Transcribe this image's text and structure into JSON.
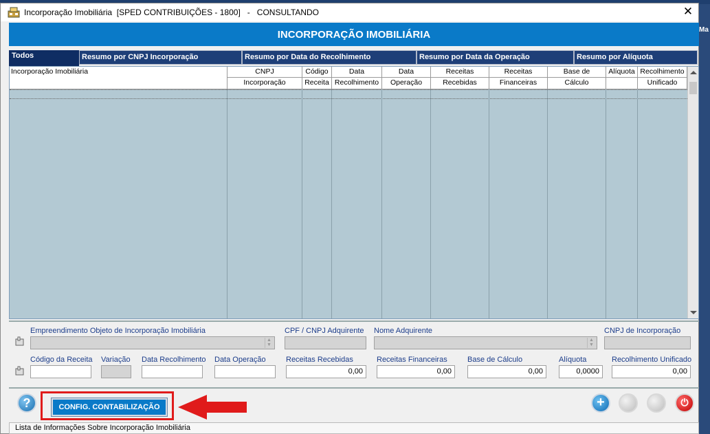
{
  "window": {
    "title": "Incorporação Imobiliária  [SPED CONTRIBUIÇÕES - 1800]   -   CONSULTANDO",
    "close_label": "✕",
    "outside_text": "Ma"
  },
  "header": {
    "title": "INCORPORAÇÃO IMOBILIÁRIA"
  },
  "tabs": [
    {
      "label": "Todos"
    },
    {
      "label": "Resumo por CNPJ Incorporação"
    },
    {
      "label": "Resumo por Data do Recolhimento"
    },
    {
      "label": "Resumo por Data da Operação"
    },
    {
      "label": "Resumo por Alíquota"
    }
  ],
  "grid": {
    "columns": [
      {
        "l1": "Incorporação Imobiliária",
        "l2": ""
      },
      {
        "l1": "CNPJ",
        "l2": "Incorporação"
      },
      {
        "l1": "Código",
        "l2": "Receita"
      },
      {
        "l1": "Data",
        "l2": "Recolhimento"
      },
      {
        "l1": "Data",
        "l2": "Operação"
      },
      {
        "l1": "Receitas",
        "l2": "Recebidas"
      },
      {
        "l1": "Receitas",
        "l2": "Financeiras"
      },
      {
        "l1": "Base de",
        "l2": "Cálculo"
      },
      {
        "l1": "Alíquota",
        "l2": ""
      },
      {
        "l1": "Recolhimento",
        "l2": "Unificado"
      }
    ]
  },
  "form": {
    "empreendimento_label": "Empreendimento Objeto de Incorporação Imobiliária",
    "cpf_label": "CPF / CNPJ Adquirente",
    "nome_label": "Nome Adquirente",
    "cnpj_inc_label": "CNPJ de Incorporação",
    "codigo_label": "Código da Receita",
    "variacao_label": "Variação",
    "data_rec_label": "Data Recolhimento",
    "data_op_label": "Data Operação",
    "rec_recebidas_label": "Receitas Recebidas",
    "rec_financeiras_label": "Receitas Financeiras",
    "base_label": "Base de Cálculo",
    "aliquota_label": "Alíquota",
    "recolhimento_label": "Recolhimento Unificado",
    "rec_recebidas_value": "0,00",
    "rec_financeiras_value": "0,00",
    "base_value": "0,00",
    "aliquota_value": "0,0000",
    "recolhimento_value": "0,00"
  },
  "buttons": {
    "help_label": "?",
    "config_label": "CONFIG. CONTABILIZAÇÃO",
    "add_label": "+",
    "power_label": "⏻"
  },
  "status": {
    "text": "Lista de Informações Sobre Incorporação Imobiliária"
  }
}
